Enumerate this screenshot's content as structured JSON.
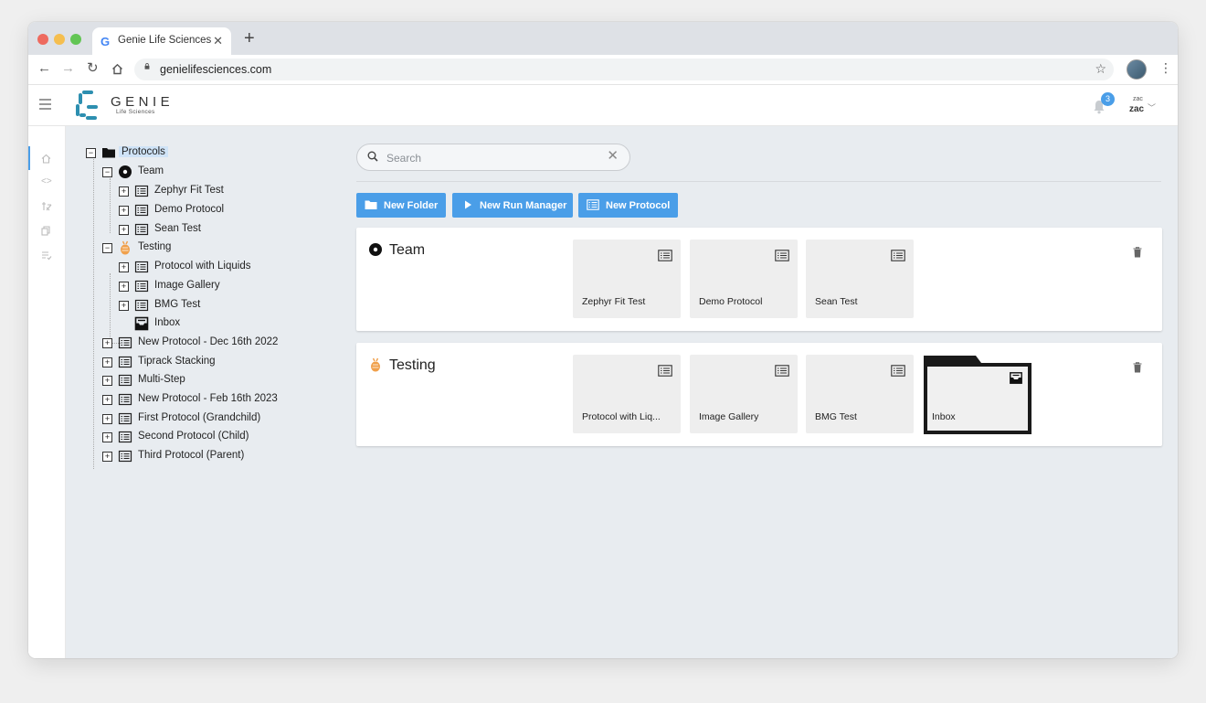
{
  "browser": {
    "tab_title": "Genie Life Sciences",
    "tab_close": "✕",
    "new_tab": "+",
    "url": "genielifesciences.com"
  },
  "app": {
    "brand": "GENIE",
    "brand_sub": "Life Sciences",
    "notifications_count": "3",
    "user_small": "zac",
    "user_name": "zac"
  },
  "tree": {
    "root": "Protocols",
    "team": "Team",
    "team_children": [
      "Zephyr Fit Test",
      "Demo Protocol",
      "Sean Test"
    ],
    "testing": "Testing",
    "testing_children": [
      "Protocol with Liquids",
      "Image Gallery",
      "BMG Test",
      "Inbox"
    ],
    "protocols": [
      "New Protocol - Dec 16th 2022",
      "Tiprack Stacking",
      "Multi-Step",
      "New Protocol - Feb 16th 2023",
      "First Protocol (Grandchild)",
      "Second Protocol (Child)",
      "Third Protocol (Parent)"
    ]
  },
  "search": {
    "placeholder": "Search",
    "value": ""
  },
  "actions": {
    "new_folder": "New Folder",
    "new_run_manager": "New Run Manager",
    "new_protocol": "New Protocol"
  },
  "sections": [
    {
      "title": "Team",
      "cards": [
        "Zephyr Fit Test",
        "Demo Protocol",
        "Sean Test"
      ]
    },
    {
      "title": "Testing",
      "cards": [
        "Protocol with Liq...",
        "Image Gallery",
        "BMG Test"
      ],
      "folder": "Inbox"
    }
  ],
  "colors": {
    "accent": "#4a9ee8",
    "testing_icon": "#f0a04b",
    "brand_teal": "#2d8fb0"
  }
}
